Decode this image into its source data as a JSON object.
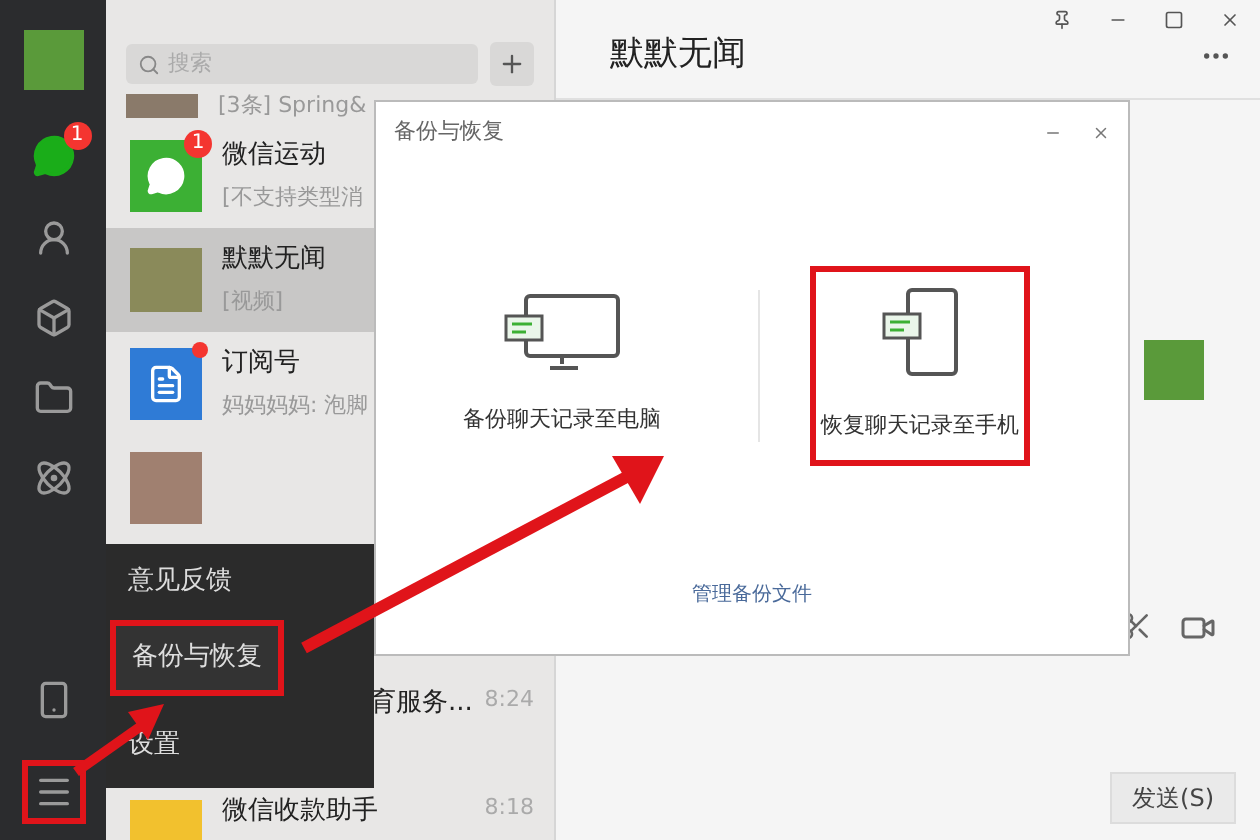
{
  "nav": [
    {
      "kind": "chats",
      "selected": true,
      "badge": "1"
    },
    {
      "kind": "contacts",
      "selected": false
    },
    {
      "kind": "collections",
      "selected": false
    },
    {
      "kind": "files",
      "selected": false
    },
    {
      "kind": "moments",
      "selected": false
    }
  ],
  "nav_bottom": [
    {
      "kind": "phone",
      "highlighted": false
    },
    {
      "kind": "menu",
      "highlighted": true
    }
  ],
  "search": {
    "placeholder": "搜索"
  },
  "chats": [
    {
      "kind": "strip",
      "preview": "[3条] Spring&",
      "selected": false
    },
    {
      "kind": "wechat",
      "name": "微信运动",
      "preview": "[不支持类型消",
      "badge": "1",
      "selected": false
    },
    {
      "kind": "photo",
      "name": "默默无闻",
      "preview": "[视频]",
      "selected": true
    },
    {
      "kind": "subscription",
      "name": "订阅号",
      "preview": "妈妈妈妈: 泡脚",
      "dot": true,
      "selected": false
    },
    {
      "kind": "grid",
      "selected": false
    },
    {
      "kind": "hidden",
      "name": "育服务...",
      "time": "8:24",
      "selected": false
    },
    {
      "kind": "payment",
      "name": "微信收款助手",
      "time": "8:18",
      "selected": false
    }
  ],
  "popup_menu": [
    {
      "label": "意见反馈",
      "highlighted": false
    },
    {
      "label": "备份与恢复",
      "highlighted": true
    },
    {
      "label": "设置",
      "highlighted": false
    }
  ],
  "conversation": {
    "title": "默默无闻",
    "send_button": "发送(S)"
  },
  "dialog": {
    "title": "备份与恢复",
    "options": [
      {
        "kind": "computer",
        "label": "备份聊天记录至电脑",
        "highlighted": false
      },
      {
        "kind": "phone",
        "label": "恢复聊天记录至手机",
        "highlighted": true
      }
    ],
    "link": "管理备份文件"
  }
}
